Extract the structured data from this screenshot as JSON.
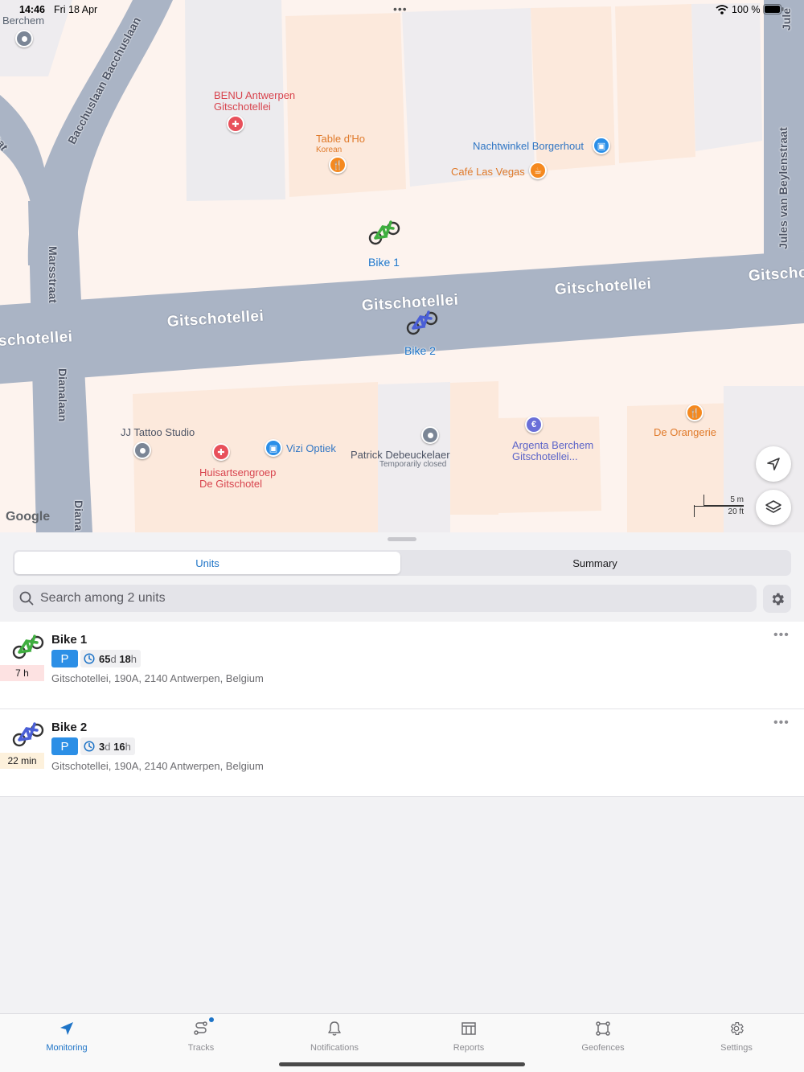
{
  "status_bar": {
    "time": "14:46",
    "date": "Fri 18 Apr",
    "dots": "•••",
    "battery": "100 %"
  },
  "map": {
    "streets": {
      "gitschotellei_1": "Gitschotellei",
      "gitschotellei_2": "Gitschotellei",
      "gitschotellei_3": "Gitschotellei",
      "gitschotellei_4": "schotellei",
      "gitschotellei_5": "Gitscho",
      "bacchuslaan": "Bacchuslaan Bacchuslaan",
      "marsstraat": "Marsstraat",
      "dianalaan": "Dianalaan",
      "diana_bottom": "Diana",
      "jules": "Jules van Beylenstraat",
      "jules_top": "Jule",
      "straat_left": "traat"
    },
    "pois": {
      "berchem": "Berchem",
      "benu": "BENU Antwerpen",
      "benu_2": "Gitschotellei",
      "table_dho": "Table d'Ho",
      "table_dho_sub": "Korean",
      "nachtwinkel": "Nachtwinkel Borgerhout",
      "cafe": "Café Las Vegas",
      "jj_tattoo": "JJ Tattoo Studio",
      "huisarts": "Huisartsengroep",
      "huisarts_2": "De Gitschotel",
      "vizi": "Vizi Optiek",
      "patrick": "Patrick Debeuckelaer",
      "patrick_sub": "Temporarily closed",
      "argenta": "Argenta Berchem",
      "argenta_2": "Gitschotellei...",
      "orangerie": "De Orangerie"
    },
    "markers": {
      "bike1": "Bike 1",
      "bike2": "Bike 2"
    },
    "scale": {
      "metric": "5 m",
      "imperial": "20 ft"
    },
    "attribution": "Google"
  },
  "panel": {
    "tabs": {
      "units": "Units",
      "summary": "Summary"
    },
    "search": {
      "placeholder": "Search among 2 units"
    },
    "units": [
      {
        "name": "Bike 1",
        "badge_time": "7 h",
        "badge_color": "#fde2e2",
        "state": "P",
        "dur_a": "65",
        "dur_a_u": "d",
        "dur_b": "18",
        "dur_b_u": "h",
        "address": "Gitschotellei, 190A, 2140 Antwerpen, Belgium",
        "bike_color": "#3fae3f"
      },
      {
        "name": "Bike 2",
        "badge_time": "22 min",
        "badge_color": "#fdf1dc",
        "state": "P",
        "dur_a": "3",
        "dur_a_u": "d",
        "dur_b": "16",
        "dur_b_u": "h",
        "address": "Gitschotellei, 190A, 2140 Antwerpen, Belgium",
        "bike_color": "#4a5fd6"
      }
    ],
    "more": "•••"
  },
  "tabbar": {
    "items": [
      {
        "label": "Monitoring",
        "icon": "navigation-arrow-icon"
      },
      {
        "label": "Tracks",
        "icon": "route-icon"
      },
      {
        "label": "Notifications",
        "icon": "bell-icon"
      },
      {
        "label": "Reports",
        "icon": "table-icon"
      },
      {
        "label": "Geofences",
        "icon": "geofence-icon"
      },
      {
        "label": "Settings",
        "icon": "gear-icon"
      }
    ],
    "active": "Monitoring"
  },
  "colors": {
    "accent": "#1e74c7",
    "road": "#aab4c5",
    "map_bg": "#fdf3ee",
    "building": "#efebeb"
  }
}
